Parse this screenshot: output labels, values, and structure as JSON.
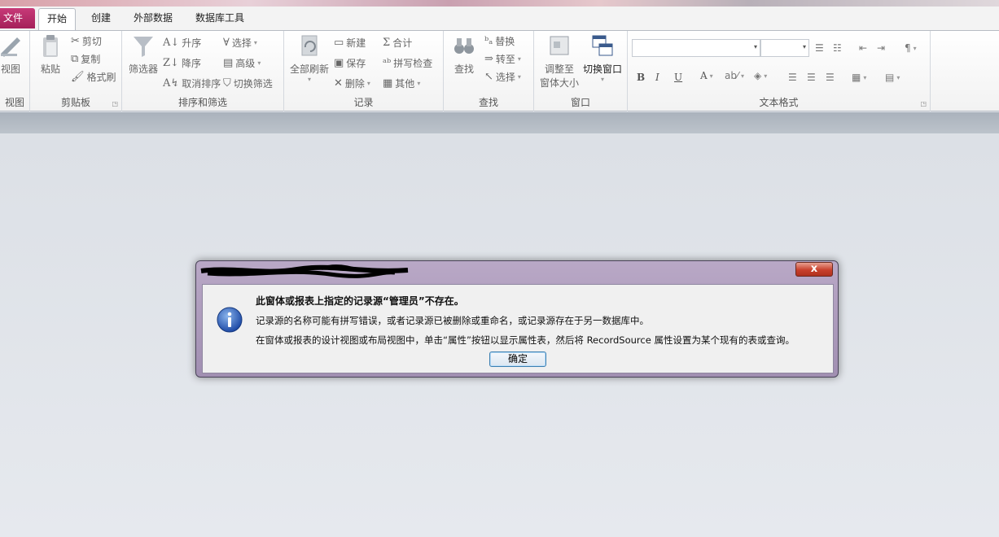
{
  "tabs": [
    {
      "label": "文件"
    },
    {
      "label": "开始"
    },
    {
      "label": "创建"
    },
    {
      "label": "外部数据"
    },
    {
      "label": "数据库工具"
    }
  ],
  "ribbon": {
    "views": {
      "label": "视图",
      "view_button": "视图"
    },
    "clipboard": {
      "label": "剪贴板",
      "paste": "粘贴",
      "cut": "剪切",
      "copy": "复制",
      "format_painter": "格式刷"
    },
    "sort_filter": {
      "label": "排序和筛选",
      "filter": "筛选器",
      "ascending": "升序",
      "descending": "降序",
      "remove_sort": "取消排序",
      "selection": "选择",
      "advanced": "高级",
      "toggle_filter": "切换筛选"
    },
    "records": {
      "label": "记录",
      "refresh_all": "全部刷新",
      "new": "新建",
      "save": "保存",
      "delete": "删除",
      "totals": "合计",
      "spelling": "拼写检查",
      "more": "其他"
    },
    "find": {
      "label": "查找",
      "find": "查找",
      "replace": "替换",
      "goto": "转至",
      "select": "选择"
    },
    "window": {
      "label": "窗口",
      "size_to_fit": "调整至",
      "size_to_fit_2": "窗体大小",
      "switch_windows": "切换窗口"
    },
    "text_format": {
      "label": "文本格式",
      "bold": "B",
      "italic": "I",
      "underline": "U",
      "font_color": "A"
    }
  },
  "dialog": {
    "title": "此窗体或报表上指定的记录源“管理员”不存在。",
    "line1": "记录源的名称可能有拼写错误，或者记录源已被删除或重命名，或记录源存在于另一数据库中。",
    "line2": "在窗体或报表的设计视图或布局视图中，单击“属性”按钮以显示属性表，然后将 RecordSource 属性设置为某个现有的表或查询。",
    "ok": "确定",
    "close": "x"
  },
  "icons": {
    "info": "info-icon",
    "close": "close-icon"
  }
}
